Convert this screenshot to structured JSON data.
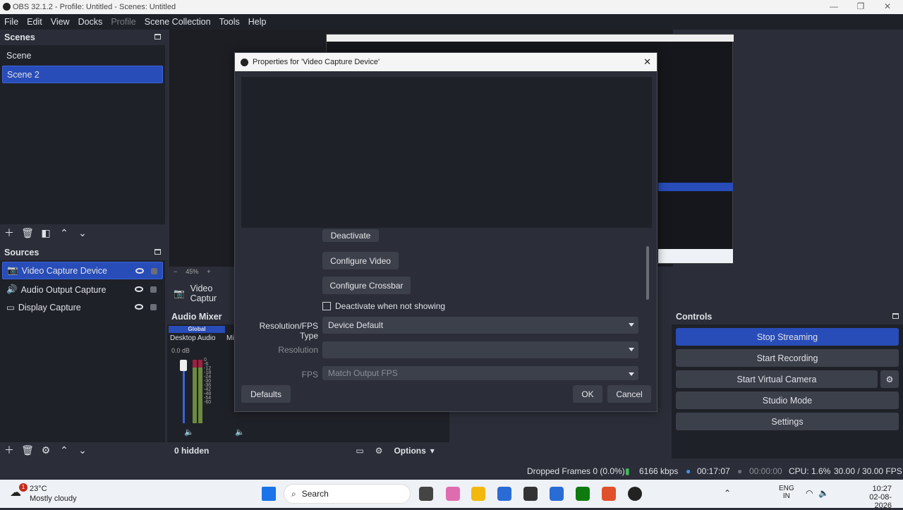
{
  "window": {
    "title": "OBS 32.1.2 - Profile: Untitled - Scenes: Untitled"
  },
  "menu": [
    "File",
    "Edit",
    "View",
    "Docks",
    "Profile",
    "Scene Collection",
    "Tools",
    "Help"
  ],
  "scenes": {
    "title": "Scenes",
    "items": [
      "Scene",
      "Scene 2"
    ],
    "selected": 1
  },
  "sources": {
    "title": "Sources",
    "items": [
      "Video Capture Device",
      "Audio Output Capture",
      "Display Capture"
    ],
    "selected": 0
  },
  "preview": {
    "zoom": "45%",
    "source_label": "Video Captur"
  },
  "audio_mixer": {
    "title": "Audio Mixer",
    "global_label": "Global",
    "channel1": "Desktop Audio",
    "channel1_db": "0.0 dB",
    "channel2": "Mi",
    "scale": [
      "0",
      "-6",
      "-12",
      "-18",
      "-24",
      "-30",
      "-36",
      "-42",
      "-48",
      "-54",
      "-60"
    ],
    "hidden": "0 hidden",
    "options": "Options"
  },
  "dialog": {
    "title": "Properties for 'Video Capture Device'",
    "deactivate": "Deactivate",
    "configure_video": "Configure Video",
    "configure_crossbar": "Configure Crossbar",
    "deactivate_checkbox": "Deactivate when not showing",
    "res_fps_label": "Resolution/FPS Type",
    "res_fps_value": "Device Default",
    "resolution_label": "Resolution",
    "resolution_value": "",
    "fps_label": "FPS",
    "fps_value": "Match Output FPS",
    "defaults": "Defaults",
    "ok": "OK",
    "cancel": "Cancel"
  },
  "controls": {
    "title": "Controls",
    "stop_streaming": "Stop Streaming",
    "start_recording": "Start Recording",
    "start_virtual_camera": "Start Virtual Camera",
    "studio_mode": "Studio Mode",
    "settings": "Settings"
  },
  "status": {
    "dropped": "Dropped Frames 0 (0.0%)",
    "kbps": "6166 kbps",
    "stream_time": "00:17:07",
    "rec_time": "00:00:00",
    "cpu": "CPU: 1.6%",
    "fps": "30.00 / 30.00 FPS"
  },
  "taskbar": {
    "weather_temp": "23°C",
    "weather_desc": "Mostly cloudy",
    "weather_badge": "1",
    "search": "Search",
    "lang1": "ENG",
    "lang2": "IN",
    "time": "10:27",
    "date": "02-08-2026"
  },
  "colors": {
    "accent": "#284cb8",
    "panel": "#1f2128",
    "bg": "#2b2e38",
    "button": "#3c404b"
  }
}
